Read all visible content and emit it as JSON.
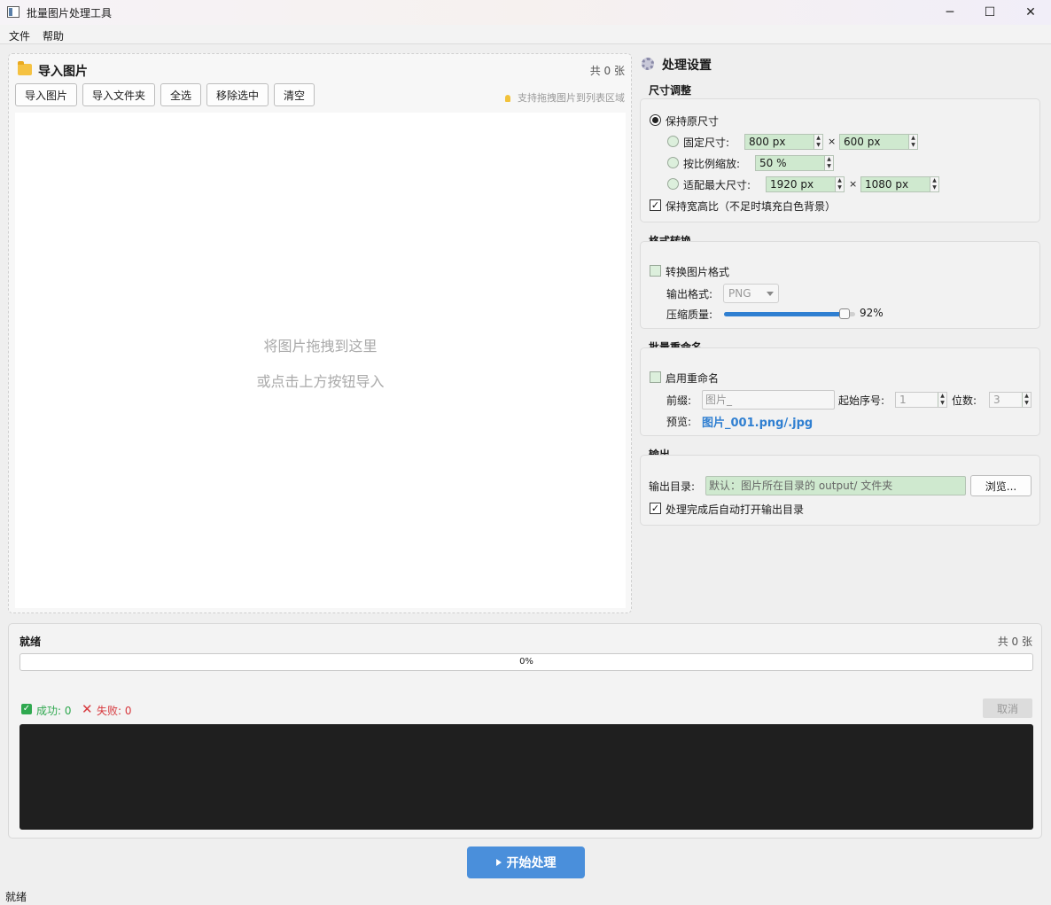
{
  "window": {
    "title": "批量图片处理工具",
    "controls": {
      "minimize": "─",
      "maximize": "☐",
      "close": "✕"
    }
  },
  "menu": {
    "file": "文件",
    "help": "帮助"
  },
  "left": {
    "title": "导入图片",
    "count": "共 0 张",
    "buttons": {
      "import_images": "导入图片",
      "import_folder": "导入文件夹",
      "select_all": "全选",
      "remove_selected": "移除选中",
      "clear": "清空"
    },
    "hint": "支持拖拽图片到列表区域",
    "dropzone": {
      "line1": "将图片拖拽到这里",
      "line2": "或点击上方按钮导入"
    }
  },
  "settings": {
    "title": "处理设置",
    "resize": {
      "label": "尺寸调整",
      "keep_original": "保持原尺寸",
      "fixed_size": "固定尺寸:",
      "fixed_width": "800 px",
      "fixed_height": "600 px",
      "scale": "按比例缩放:",
      "scale_value": "50 %",
      "fit_max": "适配最大尺寸:",
      "max_width": "1920 px",
      "max_height": "1080 px",
      "times": "×",
      "keep_ratio": "保持宽高比（不足时填充白色背景）",
      "keep_ratio_checked": true
    },
    "format": {
      "label": "格式转换",
      "convert": "转换图片格式",
      "convert_checked": false,
      "output_format_label": "输出格式:",
      "output_format": "PNG",
      "quality_label": "压缩质量:",
      "quality_value": "92%",
      "quality": 92
    },
    "rename": {
      "label": "批量重命名",
      "enable": "启用重命名",
      "enable_checked": false,
      "prefix_label": "前缀:",
      "prefix_value": "图片_",
      "start_label": "起始序号:",
      "start_value": "1",
      "digits_label": "位数:",
      "digits_value": "3",
      "preview_label": "预览:",
      "preview_value": "图片_001.png/.jpg"
    },
    "output": {
      "label": "输出",
      "dir_label": "输出目录:",
      "dir_placeholder": "默认：图片所在目录的 output/ 文件夹",
      "browse": "浏览...",
      "auto_open": "处理完成后自动打开输出目录",
      "auto_open_checked": true
    }
  },
  "progress": {
    "status": "就绪",
    "count": "共 0 张",
    "percent_text": "0%",
    "percent": 0,
    "success_label": "成功: 0",
    "fail_label": "失败: 0",
    "cancel": "取消"
  },
  "start_button": "开始处理",
  "statusbar": "就绪",
  "colors": {
    "accent": "#2f7fd1",
    "success": "#2fa84f",
    "error": "#d7383d",
    "field_green": "#cfe9cf"
  }
}
